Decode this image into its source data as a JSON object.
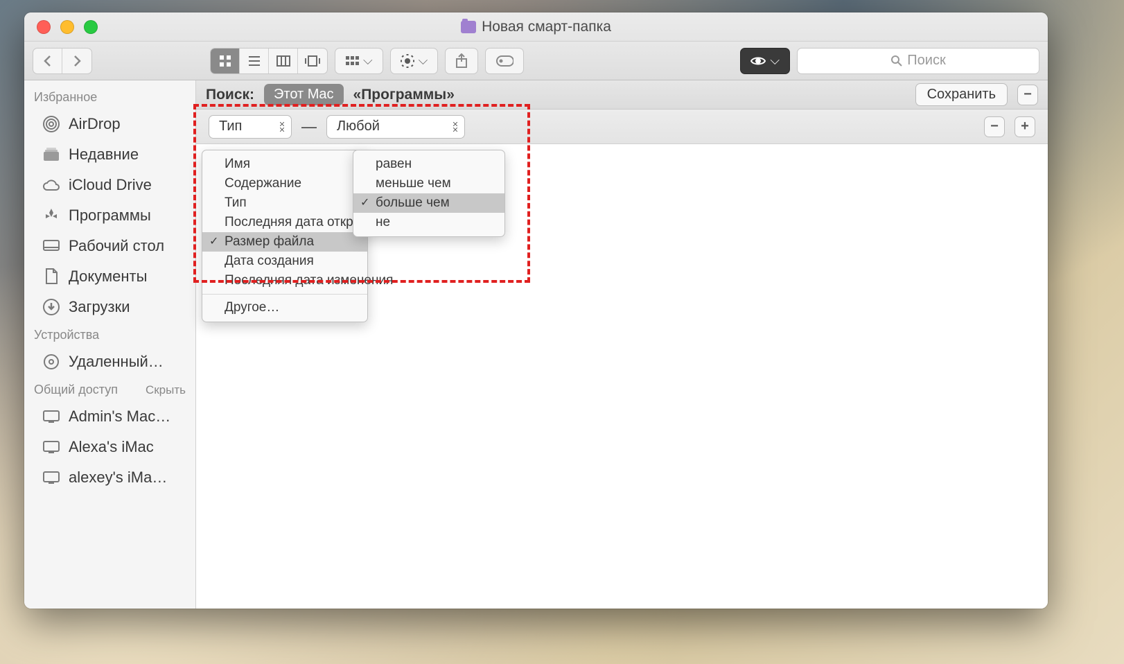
{
  "window": {
    "title": "Новая смарт-папка"
  },
  "toolbar": {
    "search_placeholder": "Поиск"
  },
  "sidebar": {
    "sections": [
      {
        "header": "Избранное",
        "hide": "",
        "items": [
          {
            "label": "AirDrop",
            "icon": "airdrop"
          },
          {
            "label": "Недавние",
            "icon": "recents"
          },
          {
            "label": "iCloud Drive",
            "icon": "cloud"
          },
          {
            "label": "Программы",
            "icon": "apps"
          },
          {
            "label": "Рабочий стол",
            "icon": "desktop"
          },
          {
            "label": "Документы",
            "icon": "documents"
          },
          {
            "label": "Загрузки",
            "icon": "downloads"
          }
        ]
      },
      {
        "header": "Устройства",
        "hide": "",
        "items": [
          {
            "label": "Удаленный…",
            "icon": "disc"
          }
        ]
      },
      {
        "header": "Общий доступ",
        "hide": "Скрыть",
        "items": [
          {
            "label": "Admin's Mac…",
            "icon": "computer"
          },
          {
            "label": "Alexa's iMac",
            "icon": "computer"
          },
          {
            "label": "alexey's iMa…",
            "icon": "computer"
          }
        ]
      }
    ]
  },
  "scope": {
    "label": "Поиск:",
    "pill": "Этот Mac",
    "sub": "«Программы»",
    "save": "Сохранить"
  },
  "criteria": {
    "attr_selected": "Тип",
    "value_selected": "Любой"
  },
  "menu1": {
    "items": [
      "Имя",
      "Содержание",
      "Тип",
      "Последняя дата открытия",
      "Размер файла",
      "Дата создания",
      "Последняя дата изменения"
    ],
    "selected": "Размер файла",
    "other": "Другое…"
  },
  "menu2": {
    "items": [
      "равен",
      "меньше чем",
      "больше чем",
      "не"
    ],
    "selected": "больше чем"
  }
}
